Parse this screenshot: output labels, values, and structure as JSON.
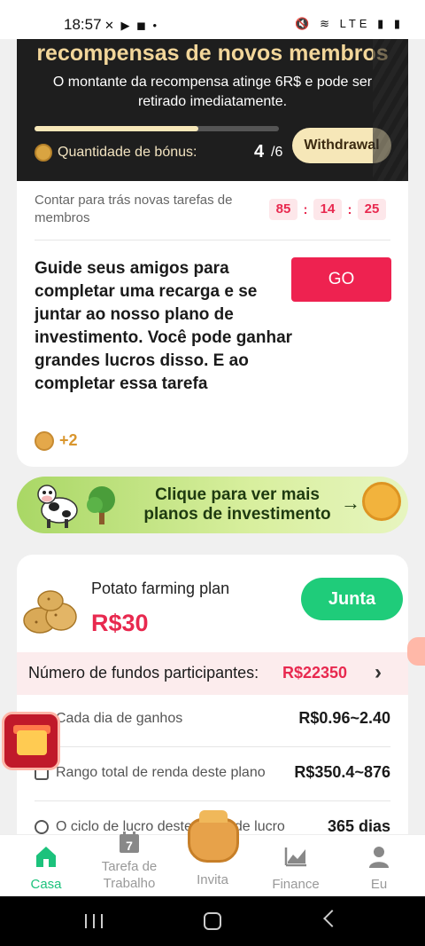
{
  "status_bar": {
    "time": "18:57",
    "left_icons": "✕ ▶ ◼ •",
    "right_icons": "🔇 ≋ LTE ▮ ▮"
  },
  "banner": {
    "title": "recompensas de novos membros",
    "description": "O montante da recompensa atinge 6R$ e pode ser retirado imediatamente.",
    "progress_fraction": 0.67,
    "bonus_label": "Quantidade de bónus:",
    "bonus_count": "4",
    "bonus_total": "/6",
    "withdraw_label": "Withdrawal"
  },
  "task": {
    "countdown_label": "Contar para trás novas tarefas de membros",
    "timer": {
      "hours": "85",
      "minutes": "14",
      "seconds": "25",
      "sep": ":"
    },
    "description": "Guide seus amigos para completar uma recarga e se juntar ao nosso plano de investimento. Você pode ganhar grandes lucros disso. E ao completar essa tarefa",
    "go_label": "GO",
    "reward": "+2"
  },
  "promo": {
    "text": "Clique para ver mais planos de investimento",
    "arrow": "→"
  },
  "plan": {
    "name": "Potato farming plan",
    "price": "R$30",
    "join_label": "Junta",
    "fund_label": "Número de fundos participantes:",
    "fund_value": "R$22350",
    "chevron": "›",
    "stats": [
      {
        "label": "Cada dia de ganhos",
        "value": "R$0.96~2.40"
      },
      {
        "label": "Rango total de renda deste plano",
        "value": "R$350.4~876"
      },
      {
        "label": "O ciclo de lucro deste plano de lucro",
        "value": "365 dias"
      }
    ]
  },
  "bottom_nav": {
    "items": [
      {
        "label": "Casa",
        "icon": "home-icon",
        "active": true
      },
      {
        "label": "Tarefa de Trabalho",
        "icon": "calendar-icon",
        "active": false
      },
      {
        "label": "Invita",
        "icon": "money-bag-icon",
        "active": false
      },
      {
        "label": "Finance",
        "icon": "chart-icon",
        "active": false
      },
      {
        "label": "Eu",
        "icon": "user-icon",
        "active": false
      }
    ],
    "calendar_day": "7"
  },
  "colors": {
    "accent_red": "#e8294f",
    "accent_green": "#1cc27c",
    "banner_gold": "#f2d69a"
  }
}
